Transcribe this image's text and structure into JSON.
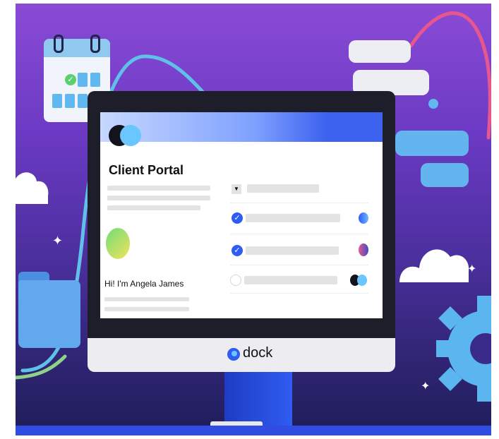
{
  "portal": {
    "title": "Client Portal",
    "greeting": "Hi! I'm Angela James"
  },
  "brand": {
    "name": "dock",
    "accent": "#2f5cf2"
  },
  "tasks": [
    {
      "checked": true
    },
    {
      "checked": true
    },
    {
      "checked": false
    }
  ],
  "icons": [
    "calendar-icon",
    "chat-bubble-icon",
    "cloud-icon",
    "folder-icon",
    "gear-icon",
    "sparkle-icon",
    "checkmark-icon",
    "dropdown-icon",
    "dock-logo-icon"
  ]
}
